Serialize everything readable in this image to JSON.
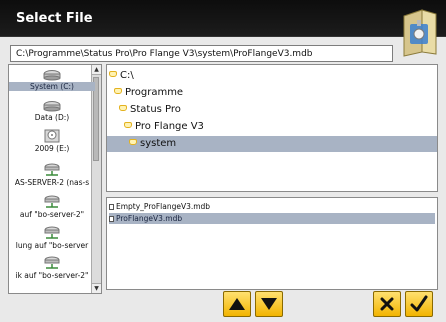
{
  "window": {
    "title": "Select File"
  },
  "path": {
    "value": "C:\\Programme\\Status Pro\\Pro Flange V3\\system\\ProFlangeV3.mdb"
  },
  "drives": [
    {
      "label": "System (C:)",
      "icon": "hard-drive-icon",
      "selected": true
    },
    {
      "label": "Data (D:)",
      "icon": "hard-drive-icon",
      "selected": false
    },
    {
      "label": "2009 (E:)",
      "icon": "cd-drive-icon",
      "selected": false
    },
    {
      "label": "AS-SERVER-2 (nas-s",
      "icon": "network-drive-icon",
      "selected": false
    },
    {
      "label": "auf \"bo-server-2\"",
      "icon": "network-drive-icon",
      "selected": false
    },
    {
      "label": "lung auf \"bo-server",
      "icon": "network-drive-icon",
      "selected": false
    },
    {
      "label": "ik auf \"bo-server-2\"",
      "icon": "network-drive-icon",
      "selected": false
    }
  ],
  "folders": [
    {
      "label": "C:\\",
      "depth": 0,
      "selected": false
    },
    {
      "label": "Programme",
      "depth": 1,
      "selected": false
    },
    {
      "label": "Status Pro",
      "depth": 2,
      "selected": false
    },
    {
      "label": "Pro Flange V3",
      "depth": 3,
      "selected": false
    },
    {
      "label": "system",
      "depth": 4,
      "selected": true
    }
  ],
  "files": [
    {
      "label": "Empty_ProFlangeV3.mdb",
      "selected": false
    },
    {
      "label": "ProFlangeV3.mdb",
      "selected": true
    }
  ],
  "buttons": {
    "up": "arrow-up-icon",
    "down": "arrow-down-icon",
    "cancel": "x-icon",
    "ok": "checkmark-icon"
  },
  "colors": {
    "selection": "#a8b3c4",
    "button": "#f2b400",
    "titlebar": "#111111"
  }
}
